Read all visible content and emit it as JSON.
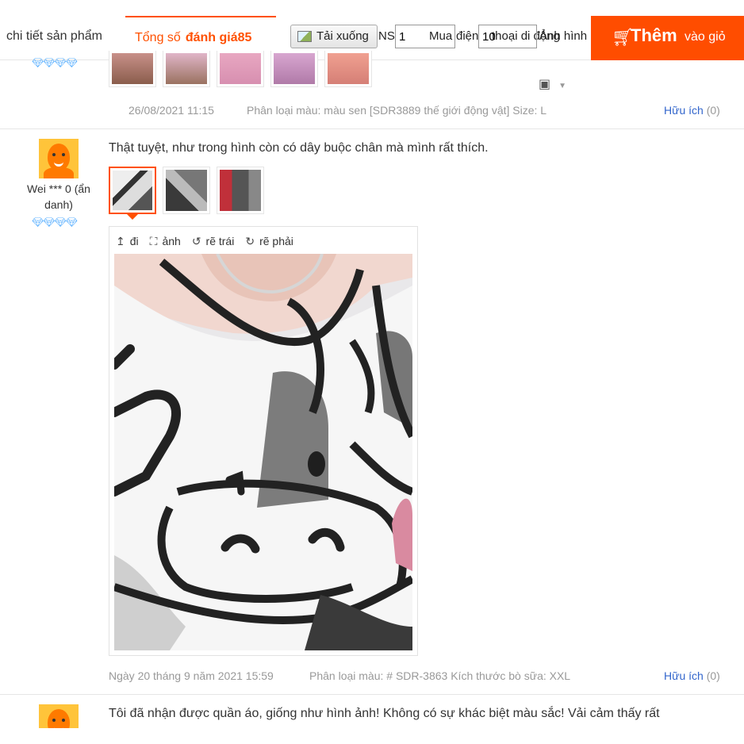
{
  "topbar": {
    "tab_detail": "chi tiết sản phẩm",
    "tab_reviews_prefix": "Tổng số",
    "tab_reviews_count": "đánh giá85",
    "download_label": "Tải xuống",
    "ns_label": "NS",
    "ns_value": "1",
    "overlap_mua": "Mua",
    "overlap_dien": "điện",
    "overlap_thoai": "thoại di động",
    "overlap_anh": "Ảnh hình",
    "quantity_value": "10",
    "cart_them": "Thêm",
    "cart_vaogio": "vào giỏ",
    "accent_color": "#ff4d00"
  },
  "review_top": {
    "date": "26/08/2021 11:15",
    "variant": "Phân loại màu: màu sen [SDR3889 thế giới động vật] Size: L",
    "helpful_label": "Hữu ích",
    "helpful_count": "(0)",
    "qr_icon": "qr-code-icon"
  },
  "review_main": {
    "user": "Wei *** 0 (ẩn danh)",
    "text": "Thật tuyệt, như trong hình còn có dây buộc chân mà mình rất thích.",
    "viewer_tools": [
      {
        "icon": "arrow-up-icon",
        "label": "đi"
      },
      {
        "icon": "fullscreen-icon",
        "label": "ảnh"
      },
      {
        "icon": "rotate-left-icon",
        "label": "rẽ trái"
      },
      {
        "icon": "rotate-right-icon",
        "label": "rẽ phải"
      }
    ],
    "date": "Ngày 20 tháng 9 năm 2021 15:59",
    "variant": "Phân loại màu: # SDR-3863 Kích thước bò sữa: XXL",
    "helpful_label": "Hữu ích",
    "helpful_count": "(0)"
  },
  "review_next": {
    "text": "Tôi đã nhận được quần áo, giống như hình ảnh! Không có sự khác biệt màu sắc! Vải cảm thấy rất"
  }
}
